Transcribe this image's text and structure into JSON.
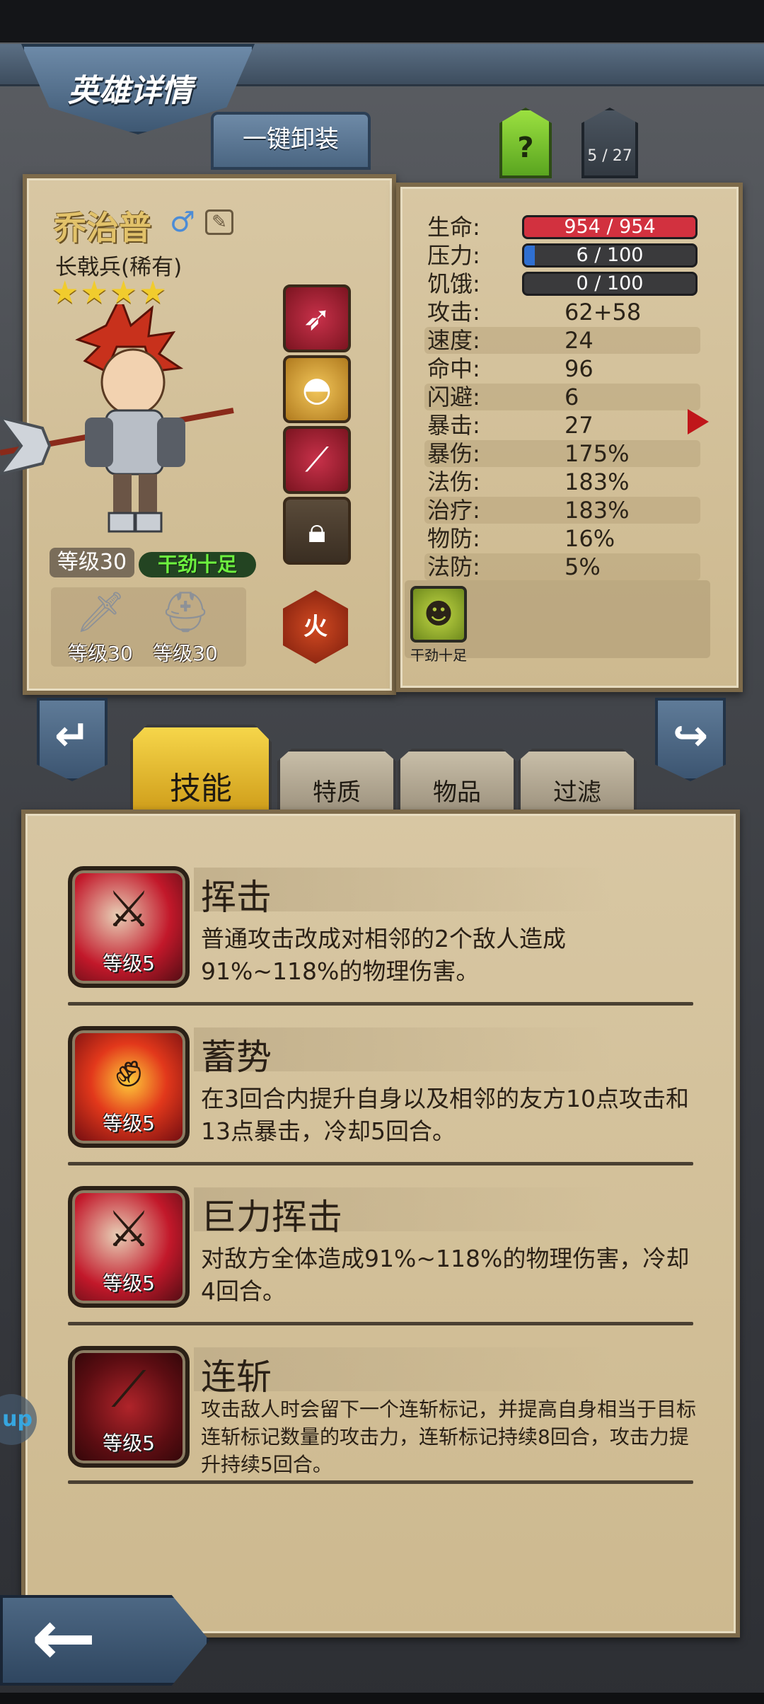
{
  "header": {
    "title": "英雄详情"
  },
  "toolbar": {
    "unequip_all": "一键卸装",
    "help": "?",
    "page_counter": "5 / 27"
  },
  "hero": {
    "name": "乔治普",
    "gender": "♂",
    "class": "长戟兵(稀有)",
    "stars": "★★★★",
    "star_count": 4,
    "level": "等级30",
    "status_trait": "干劲十足",
    "element": "火",
    "weapon_level": "等级30",
    "armor_level": "等级30"
  },
  "stats": {
    "hp": {
      "label": "生命:",
      "value": "954 / 954",
      "fraction": 1.0,
      "color": "#d2313f"
    },
    "stress": {
      "label": "压力:",
      "value": "6 / 100",
      "fraction": 0.06,
      "color": "#2f6fd0"
    },
    "hunger": {
      "label": "饥饿:",
      "value": "0 / 100",
      "fraction": 0.0,
      "color": "#555555"
    },
    "rows": [
      {
        "label": "攻击:",
        "value": "62+58"
      },
      {
        "label": "速度:",
        "value": "24"
      },
      {
        "label": "命中:",
        "value": "96"
      },
      {
        "label": "闪避:",
        "value": "6"
      },
      {
        "label": "暴击:",
        "value": "27"
      },
      {
        "label": "暴伤:",
        "value": "175%"
      },
      {
        "label": "法伤:",
        "value": "183%"
      },
      {
        "label": "治疗:",
        "value": "183%"
      },
      {
        "label": "物防:",
        "value": "16%"
      },
      {
        "label": "法防:",
        "value": "5%"
      }
    ],
    "trait_icon_label": "干劲十足"
  },
  "tabs": [
    {
      "label": "技能",
      "active": true
    },
    {
      "label": "特质",
      "active": false
    },
    {
      "label": "物品",
      "active": false
    },
    {
      "label": "过滤",
      "active": false
    }
  ],
  "skills": [
    {
      "name": "挥击",
      "level": "等级5",
      "desc": "普通攻击改成对相邻的2个敌人造成91%~118%的物理伤害。"
    },
    {
      "name": "蓄势",
      "level": "等级5",
      "desc": "在3回合内提升自身以及相邻的友方10点攻击和13点暴击，冷却5回合。"
    },
    {
      "name": "巨力挥击",
      "level": "等级5",
      "desc": "对敌方全体造成91%~118%的物理伤害，冷却4回合。"
    },
    {
      "name": "连斩",
      "level": "等级5",
      "desc": "攻击敌人时会留下一个连斩标记，并提高自身相当于目标连斩标记数量的攻击力，连斩标记持续8回合，攻击力提升持续5回合。"
    }
  ],
  "side_chip": "up",
  "icons": {
    "slot1": "crossbow-icon",
    "slot2": "pouch-icon",
    "slot3": "scroll-icon",
    "slot4": "lock-icon",
    "weapon": "sword-icon",
    "armor": "helmet-icon"
  }
}
